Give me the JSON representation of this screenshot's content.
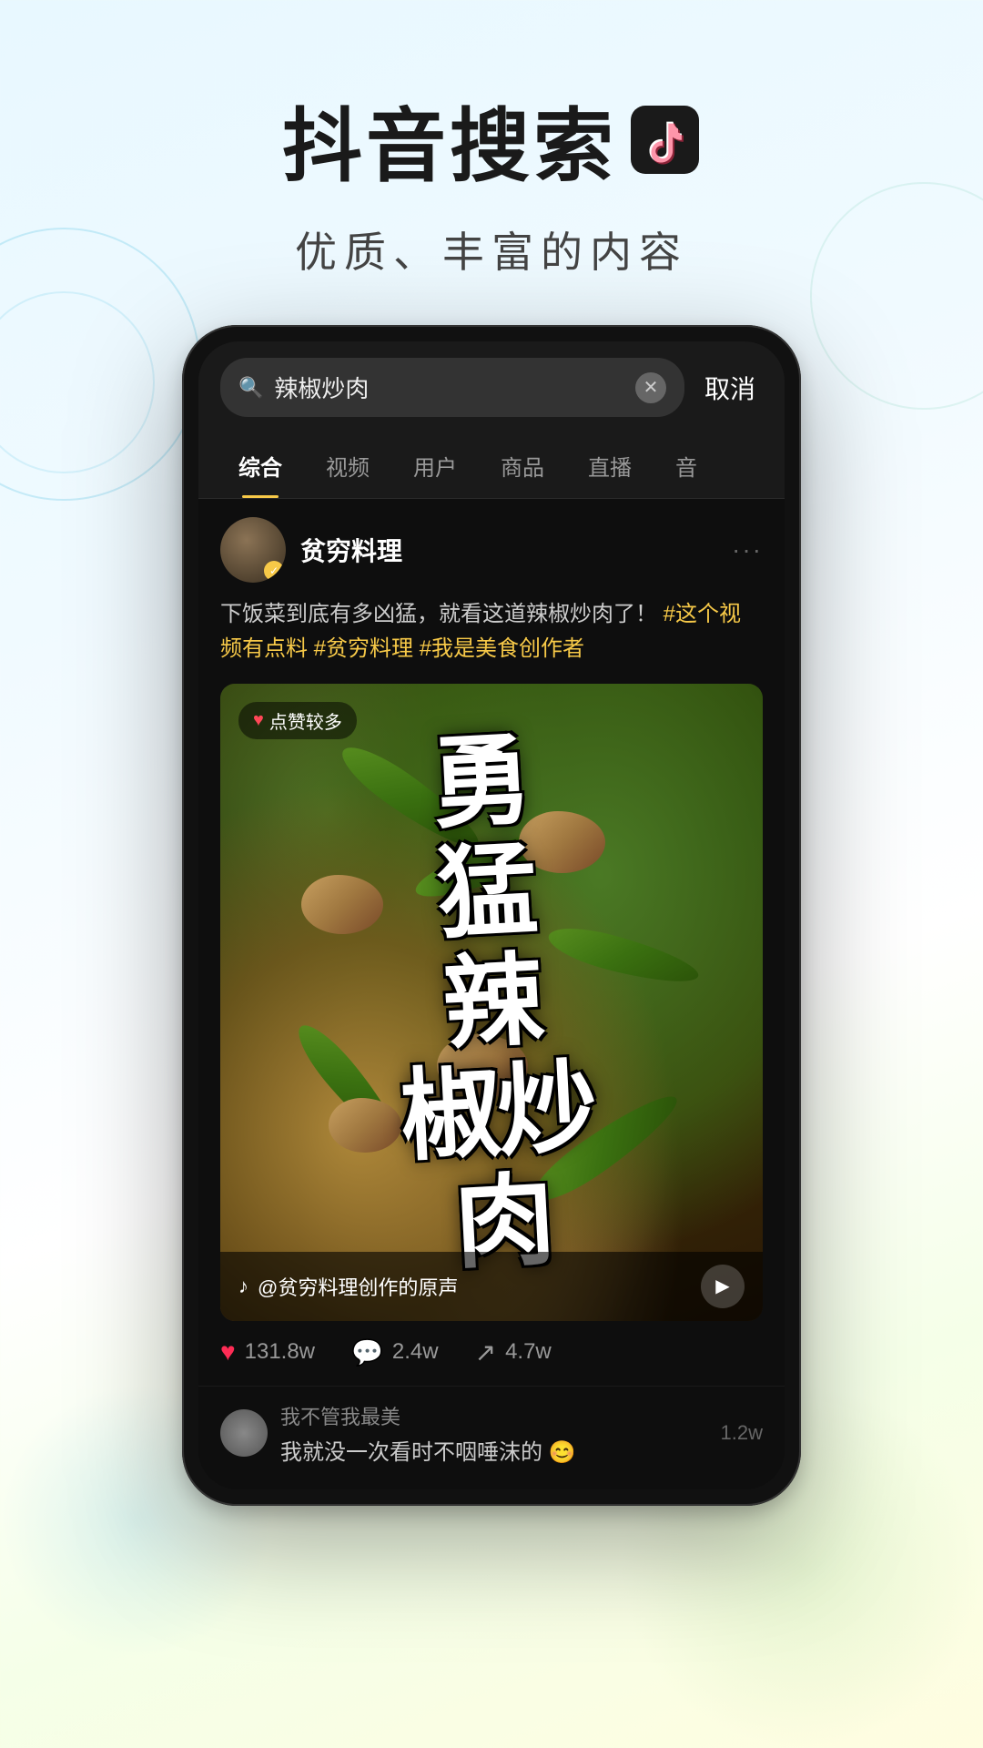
{
  "header": {
    "title": "抖音搜索",
    "tiktok_icon": "♪",
    "subtitle": "优质、丰富的内容"
  },
  "search": {
    "query": "辣椒炒肉",
    "clear_icon": "×",
    "cancel_label": "取消"
  },
  "tabs": [
    {
      "label": "综合",
      "active": true
    },
    {
      "label": "视频",
      "active": false
    },
    {
      "label": "用户",
      "active": false
    },
    {
      "label": "商品",
      "active": false
    },
    {
      "label": "直播",
      "active": false
    },
    {
      "label": "音",
      "active": false
    }
  ],
  "post": {
    "user_name": "贫穷料理",
    "verified": true,
    "description": "下饭菜到底有多凶猛，就看这道辣椒炒肉了！",
    "hashtags": [
      "#这个视频有点料",
      "#贫穷料理",
      "#我是美食创作者"
    ],
    "likes_badge": "点赞较多",
    "video_title_line1": "勇",
    "video_title_line2": "猛",
    "video_title_line3": "辣",
    "video_title_line4": "椒炒",
    "video_title_line5": "肉",
    "video_text": "勇\n猛\n辣\n椒炒\n肉",
    "audio_label": "@贫穷料理创作的原声",
    "tiktok_symbol": "♪",
    "stats": {
      "likes": "131.8w",
      "comments": "2.4w",
      "shares": "4.7w"
    }
  },
  "comments": [
    {
      "user": "我不管我最美",
      "text": "我就没一次看时不咽唾沫的 😊",
      "likes": "1.2w"
    }
  ]
}
